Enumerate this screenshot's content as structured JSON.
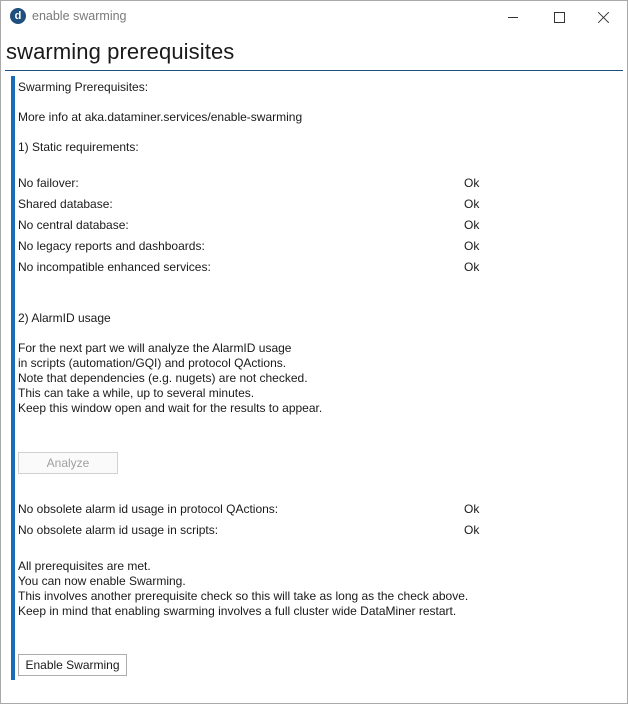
{
  "window": {
    "title": "enable swarming",
    "logo_letter": "d"
  },
  "page": {
    "title": "swarming prerequisites"
  },
  "intro": {
    "heading": "Swarming Prerequisites:",
    "more_info": "More info at aka.dataminer.services/enable-swarming"
  },
  "static_requirements": {
    "heading": "1) Static requirements:",
    "checks": [
      {
        "label": "No failover:",
        "status": "Ok"
      },
      {
        "label": "Shared database:",
        "status": "Ok"
      },
      {
        "label": "No central database:",
        "status": "Ok"
      },
      {
        "label": "No legacy reports and dashboards:",
        "status": "Ok"
      },
      {
        "label": "No incompatible enhanced services:",
        "status": "Ok"
      }
    ]
  },
  "alarmid": {
    "heading": "2) AlarmID usage",
    "description": [
      "For the next part we will analyze the AlarmID usage",
      "in scripts (automation/GQI) and protocol QActions.",
      "Note that dependencies (e.g. nugets) are not checked.",
      "This can take a while, up to several minutes.",
      "Keep this window open and wait for the results to appear."
    ],
    "analyze_label": "Analyze",
    "checks": [
      {
        "label": "No obsolete alarm id usage in protocol QActions:",
        "status": "Ok"
      },
      {
        "label": "No obsolete alarm id usage in scripts:",
        "status": "Ok"
      }
    ]
  },
  "result": {
    "lines": [
      "All prerequisites are met.",
      "You can now enable Swarming.",
      "This involves another prerequisite check so this will take as long as the check above.",
      "Keep in mind that enabling swarming involves a full cluster wide DataMiner restart."
    ],
    "enable_label": "Enable Swarming"
  }
}
